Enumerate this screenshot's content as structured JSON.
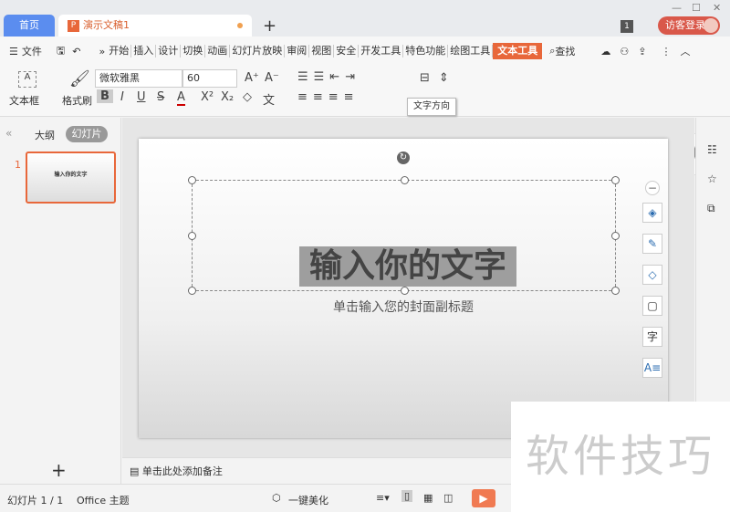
{
  "tabbar": {
    "home": "首页",
    "doc": "演示文稿1",
    "new_tab": "+",
    "badge": "1",
    "login": "访客登录"
  },
  "menu": {
    "file": "文件",
    "items": [
      "开始",
      "插入",
      "设计",
      "切换",
      "动画",
      "幻灯片放映",
      "审阅",
      "视图",
      "安全",
      "开发工具",
      "特色功能",
      "绘图工具",
      "文本工具"
    ],
    "active": "文本工具",
    "search": "查找"
  },
  "ribbon": {
    "textbox": "文本框",
    "format_painter": "格式刷",
    "font": "微软雅黑",
    "size": "60",
    "tooltip": "文字方向",
    "style_colors": [
      "#111111",
      "#4a86d8",
      "#5aaee0",
      "#e8a090",
      "#f0b040",
      "#888888"
    ],
    "style_letter": "A"
  },
  "left": {
    "outline": "大纲",
    "slides": "幻灯片",
    "slide_no": "1",
    "thumb_title": "输入你的文字",
    "add": "+"
  },
  "slide": {
    "title": "输入你的文字",
    "subtitle": "单击输入您的封面副标题"
  },
  "notes": {
    "placeholder": "单击此处添加备注"
  },
  "status": {
    "slide": "幻灯片 1 / 1",
    "theme": "Office 主题",
    "beautify": "一键美化"
  },
  "watermark": "软件技巧"
}
